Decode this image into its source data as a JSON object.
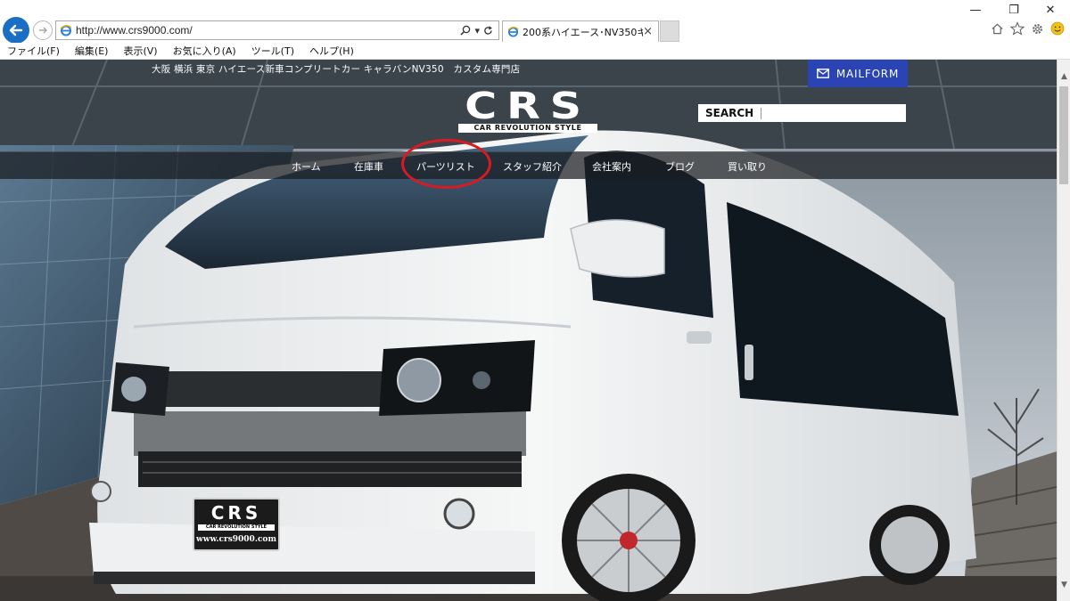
{
  "browser": {
    "url": "http://www.crs9000.com/",
    "tab_title": "200系ハイエース･NV350キャラ...",
    "tab_close": "×",
    "window_controls": {
      "minimize": "—",
      "restore": "❐",
      "close": "✕"
    },
    "icons": [
      "back-arrow-icon",
      "forward-arrow-icon",
      "ie-logo-icon",
      "search-icon",
      "dropdown-icon",
      "refresh-icon",
      "home-icon",
      "favorites-star-icon",
      "gear-icon",
      "smiley-icon"
    ]
  },
  "menubar": {
    "items": [
      "ファイル(F)",
      "編集(E)",
      "表示(V)",
      "お気に入り(A)",
      "ツール(T)",
      "ヘルプ(H)"
    ]
  },
  "site": {
    "tagline": "大阪 横浜 東京 ハイエース新車コンプリートカー キャラバンNV350　カスタム専門店",
    "mailform_label": "MAILFORM",
    "logo": {
      "text": "CRS",
      "subtitle": "CAR REVOLUTION STYLE"
    },
    "search_label": "SEARCH",
    "search_value": "",
    "nav": [
      "ホーム",
      "在庫車",
      "パーツリスト",
      "スタッフ紹介",
      "会社案内",
      "ブログ",
      "買い取り"
    ],
    "highlighted_nav": "パーツリスト",
    "highlight_color": "#d81b23",
    "plate": {
      "logo": "CRS",
      "subtitle": "CAR REVOLUTION STYLE",
      "url": "www.crs9000.com"
    }
  },
  "colors": {
    "back_button": "#1a6fc4",
    "mailform_bg": "#2a44b4",
    "nav_bg": "#1c1f23"
  }
}
